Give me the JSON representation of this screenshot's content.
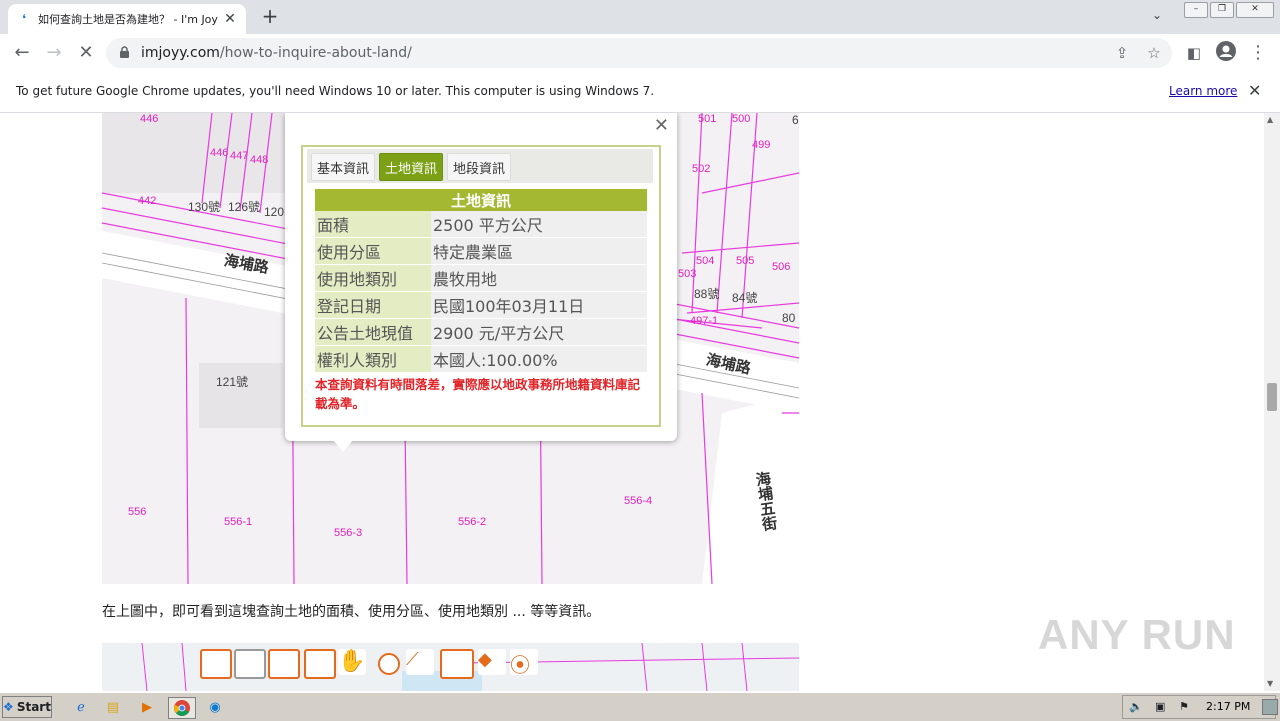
{
  "browser": {
    "tab_title": "如何查詢土地是否為建地？ - I'm Joy",
    "url_domain": "imjoyy.com",
    "url_path": "/how-to-inquire-about-land/",
    "infobar_message": "To get future Google Chrome updates, you'll need Windows 10 or later. This computer is using Windows 7.",
    "infobar_link": "Learn more"
  },
  "popup": {
    "tabs": [
      "基本資訊",
      "土地資訊",
      "地段資訊"
    ],
    "active_tab": 1,
    "table_title": "土地資訊",
    "rows": [
      {
        "label": "面積",
        "value": "2500 平方公尺"
      },
      {
        "label": "使用分區",
        "value": "特定農業區"
      },
      {
        "label": "使用地類別",
        "value": "農牧用地"
      },
      {
        "label": "登記日期",
        "value": "民國100年03月11日"
      },
      {
        "label": "公告土地現值",
        "value": "2900 元/平方公尺"
      },
      {
        "label": "權利人類別",
        "value": "本國人:100.00%"
      }
    ],
    "disclaimer": "本查詢資料有時間落差，實際應以地政事務所地籍資料庫記載為準。"
  },
  "map": {
    "roads": [
      "海埔路",
      "海埔路",
      "海埔五街"
    ],
    "parcels": [
      "446",
      "447",
      "448",
      "442",
      "130號",
      "126號",
      "120",
      "121號",
      "556",
      "556-1",
      "556-3",
      "556-2",
      "556-4",
      "501",
      "500",
      "499",
      "502",
      "504",
      "505",
      "506",
      "503",
      "88號",
      "84號",
      "80",
      "497-1",
      "6"
    ]
  },
  "article": {
    "caption": "在上圖中，即可看到這塊查詢土地的面積、使用分區、使用地類別 ... 等等資訊。"
  },
  "watermark": "ANY RUN",
  "taskbar": {
    "start_label": "Start",
    "clock": "2:17 PM"
  }
}
